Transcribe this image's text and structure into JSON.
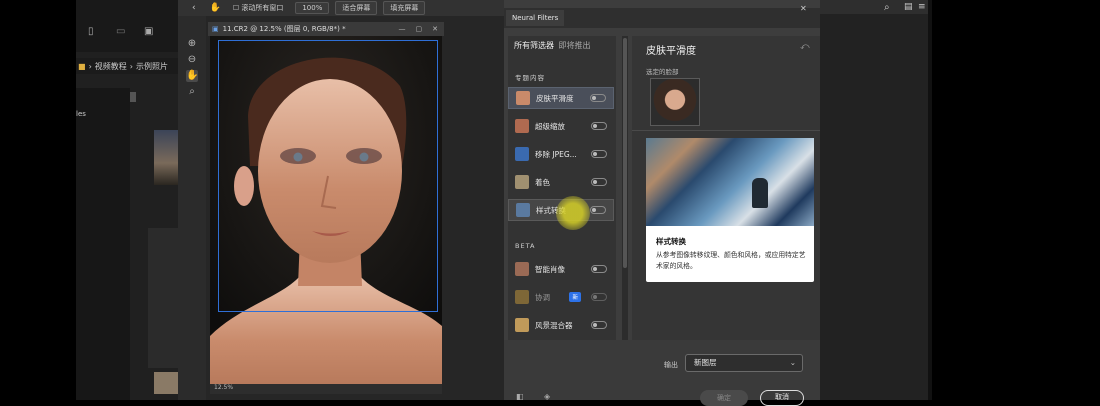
{
  "explorer": {
    "path_items": [
      "视频教程",
      "示例照片"
    ],
    "left_partial": "les"
  },
  "photoshop": {
    "options_bar": {
      "scroll_all": "滚动所有窗口",
      "zoom": "100%",
      "fit_screen": "适合屏幕",
      "fill_screen": "填充屏幕"
    },
    "document": {
      "tab_title": "11.CR2 @ 12.5% (图层 0, RGB/8*) *",
      "zoom_status": "12.5%"
    }
  },
  "neural_filters": {
    "panel_title": "Neural Filters",
    "tabs": [
      "所有筛选器",
      "即将推出"
    ],
    "sections": {
      "featured": "专题内容",
      "beta": "BETA"
    },
    "featured_items": [
      {
        "label": "皮肤平滑度",
        "selected": true,
        "icon": "skin-thumb",
        "color": "#c98a6a"
      },
      {
        "label": "超级缩放",
        "selected": false,
        "icon": "zoom-thumb",
        "color": "#b06a50"
      },
      {
        "label": "移除 JPEG...",
        "selected": false,
        "icon": "jpeg-thumb",
        "color": "#3a6ab0"
      },
      {
        "label": "着色",
        "selected": false,
        "icon": "colorize-thumb",
        "color": "#a09070"
      },
      {
        "label": "样式转换",
        "selected": false,
        "icon": "style-thumb",
        "color": "#5a7aa0"
      }
    ],
    "beta_items": [
      {
        "label": "智能肖像",
        "badge": "",
        "icon": "portrait-thumb",
        "color": "#9a6a55"
      },
      {
        "label": "协调",
        "badge": "新",
        "icon": "harmonize-thumb",
        "color": "#b08a3a"
      },
      {
        "label": "风景混合器",
        "badge": "",
        "icon": "landscape-thumb",
        "color": "#c09a5a"
      }
    ],
    "detail": {
      "title": "皮肤平滑度",
      "selected_face_label": "选定的脸部"
    },
    "card": {
      "title": "样式转换",
      "description": "从参考图像转移纹理、颜色和风格，或应用特定艺术家的风格。"
    },
    "output": {
      "label": "输出",
      "value": "新图层"
    },
    "buttons": {
      "ok": "确定",
      "cancel": "取消"
    }
  }
}
